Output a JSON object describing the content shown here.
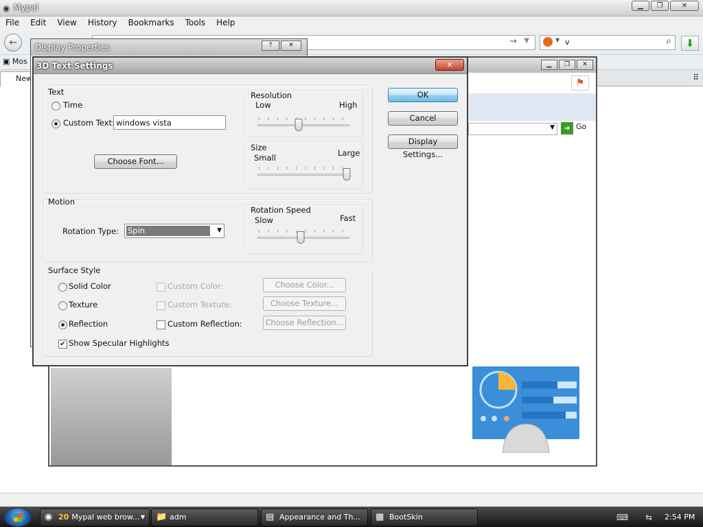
{
  "browser": {
    "title": "Mypal",
    "menu": [
      "File",
      "Edit",
      "View",
      "History",
      "Bookmarks",
      "Tools",
      "Help"
    ],
    "search_value": "v",
    "bookmark_label": "Mos",
    "tab_label": "New"
  },
  "display_properties": {
    "title": "Display Properties",
    "help_btn": "?",
    "close_btn": "✕"
  },
  "dialog": {
    "title": "3D Text Settings",
    "close_btn": "✕",
    "text_group": {
      "label": "Text",
      "time_label": "Time",
      "custom_text_label": "Custom Text:",
      "custom_text_value": "windows vista",
      "selected": "custom",
      "choose_font_label": "Choose Font..."
    },
    "resolution": {
      "label": "Resolution",
      "low": "Low",
      "high": "High",
      "value": 0.45
    },
    "size": {
      "label": "Size",
      "small": "Small",
      "large": "Large",
      "value": 1.0
    },
    "motion": {
      "label": "Motion",
      "rotation_type_label": "Rotation Type:",
      "rotation_type_value": "Spin"
    },
    "rotation_speed": {
      "label": "Rotation Speed",
      "slow": "Slow",
      "fast": "Fast",
      "value": 0.47
    },
    "surface": {
      "label": "Surface Style",
      "solid_color": "Solid Color",
      "texture": "Texture",
      "reflection": "Reflection",
      "selected": "reflection",
      "custom_color": "Custom Color:",
      "custom_texture": "Custom Texture:",
      "custom_reflection": "Custom Reflection:",
      "choose_color": "Choose Color...",
      "choose_texture": "Choose Texture...",
      "choose_reflection": "Choose Reflection...",
      "specular_label": "Show Specular Highlights",
      "specular_checked": true
    },
    "buttons": {
      "ok": "OK",
      "cancel": "Cancel",
      "display_settings": "Display Settings..."
    }
  },
  "control_panel": {
    "go_label": "Go"
  },
  "taskbar": {
    "tasks": [
      {
        "count": "20",
        "label": "Mypal web brow..."
      },
      {
        "label": "adm"
      },
      {
        "label": "Appearance and Th..."
      },
      {
        "label": "BootSkin"
      }
    ],
    "clock": "2:54 PM"
  },
  "colors": {
    "accent": "#3c7fb1",
    "dialog_bg": "#f0f0f0",
    "taskbar": "#1e1e1e"
  }
}
